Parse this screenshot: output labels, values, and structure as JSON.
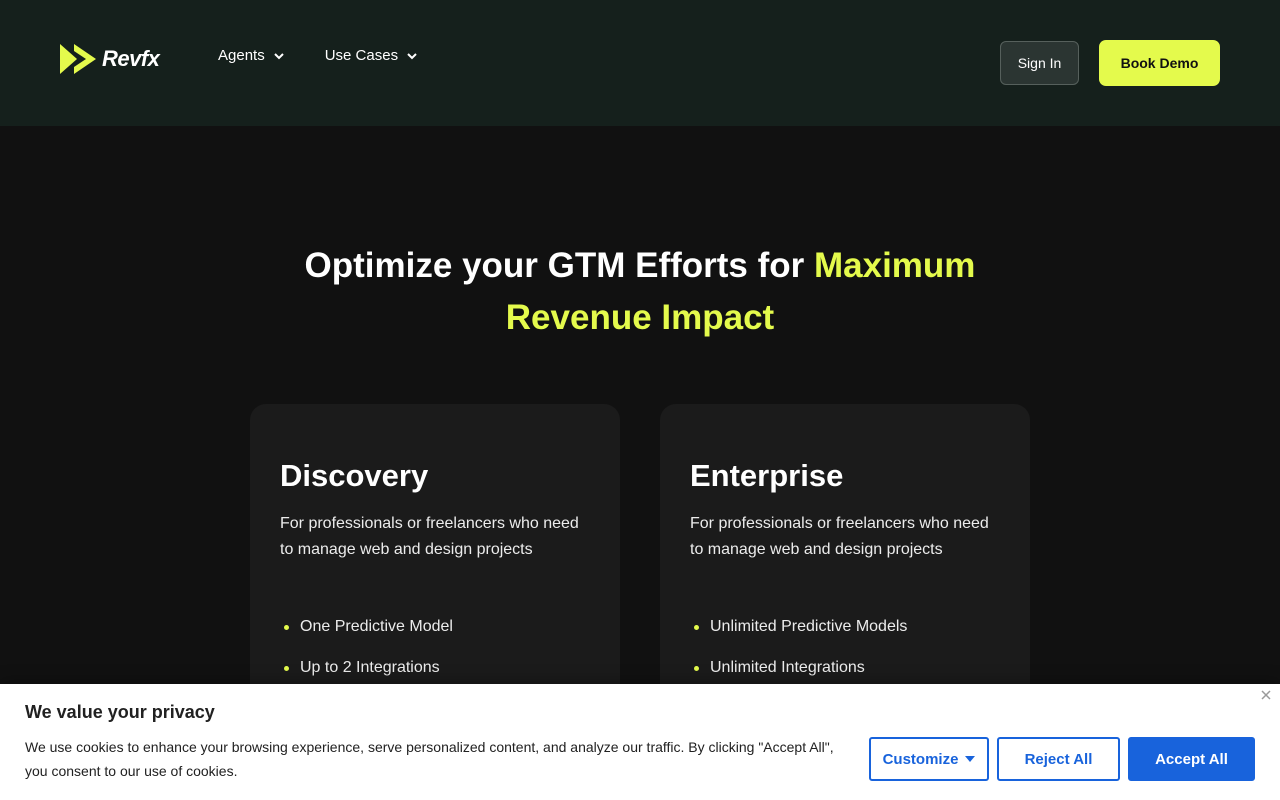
{
  "header": {
    "logo_text": "Revfx",
    "nav": [
      {
        "label": "Agents"
      },
      {
        "label": "Use Cases"
      }
    ],
    "sign_in_label": "Sign In",
    "book_demo_label": "Book Demo"
  },
  "hero": {
    "title_plain": "Optimize your GTM Efforts for ",
    "title_accent": "Maximum Revenue Impact"
  },
  "plans": [
    {
      "name": "Discovery",
      "description": "For professionals or freelancers who need to manage web and design projects",
      "features": [
        "One Predictive Model",
        "Up to 2 Integrations"
      ]
    },
    {
      "name": "Enterprise",
      "description": "For professionals or freelancers who need to manage web and design projects",
      "features": [
        "Unlimited Predictive Models",
        "Unlimited Integrations"
      ]
    }
  ],
  "cookie": {
    "title": "We value your privacy",
    "text": "We use cookies to enhance your browsing experience, serve personalized content, and analyze our traffic. By clicking \"Accept All\", you consent to our use of cookies.",
    "customize_label": "Customize",
    "reject_label": "Reject All",
    "accept_label": "Accept All"
  },
  "colors": {
    "accent": "#e4fa4c",
    "header_bg": "#15201c",
    "page_bg": "#111111",
    "card_bg": "#1b1b1b",
    "cookie_primary": "#1863dc"
  },
  "icons": {
    "logo": "double-play-arrow-icon",
    "nav_chevron": "chevron-down-icon",
    "cookie_close": "close-icon",
    "customize_caret": "caret-down-icon"
  }
}
